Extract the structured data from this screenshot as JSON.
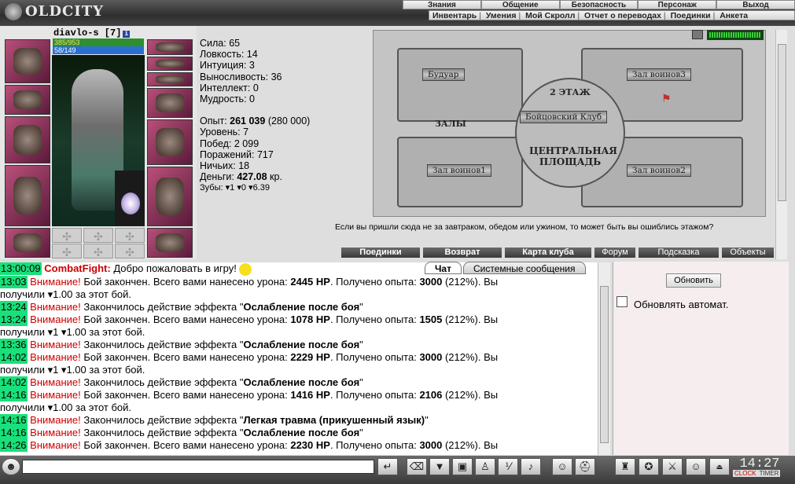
{
  "app": {
    "logo": "OLDCITY"
  },
  "menu_top": [
    "Знания",
    "Общение",
    "Безопасность",
    "Персонаж",
    "Выход"
  ],
  "menu_sub": [
    "Инвентарь",
    "Умения",
    "Мой Скролл",
    "Отчет о переводах",
    "Поединки",
    "Анкета"
  ],
  "character": {
    "nick": "diavlo-s [7]",
    "level_badge": "i",
    "hp": "385/953",
    "mp": "58/149",
    "avatar_icon": "armored-warrior-icon",
    "pet_icon": "pet-icon",
    "slot_icon": "equipment-slot-icon",
    "empty_slot_icon": "empty-slot-icon",
    "hp_fraction": 0.404,
    "mp_fraction": 0.389
  },
  "stats": {
    "strength": "Сила: 65",
    "agility": "Ловкость: 14",
    "intuition": "Интуиция: 3",
    "endurance": "Выносливость: 36",
    "intellect": "Интеллект: 0",
    "wisdom": "Мудрость: 0",
    "exp_label": "Опыт: ",
    "exp_value": "261 039",
    "exp_next": " (280 000)",
    "level": "Уровень: 7",
    "wins": "Побед: 2 099",
    "losses": "Поражений: 717",
    "draws": "Ничьих: 18",
    "money_label": "Деньги: ",
    "money_value": "427.08",
    "money_unit": " кр.",
    "teeth": "Зубы: ",
    "teeth_1": "1",
    "teeth_2": "0",
    "teeth_3": "6.39"
  },
  "map": {
    "room_boudoir": "Будуар",
    "room_warriors3": "Зал воинов3",
    "room_warriors1": "Зал воинов1",
    "room_warriors2": "Зал воинов2",
    "floor": "2 ЭТАЖ",
    "club": "Бойцовский Клуб",
    "halls": "ЗАЛЫ",
    "central": "ЦЕНТРАЛЬНАЯ ПЛОЩАДЬ",
    "message": "Если вы пришли сюда не за завтраком, обедом или ужином, то может быть вы ошиблись этажом?"
  },
  "map_buttons": [
    "Поединки",
    "Возврат",
    "Карта клуба",
    "Форум",
    "Подсказка",
    "Объекты"
  ],
  "chat_tabs": {
    "chat": "Чат",
    "system": "Системные сообщения"
  },
  "chat": [
    {
      "time": "13:00:09",
      "parts": [
        {
          "c": "cf",
          "t": "CombatFight:"
        },
        {
          "t": " Добро пожаловать в игру! "
        }
      ]
    },
    {
      "time": "13:03",
      "parts": [
        {
          "c": "w",
          "t": "Внимание!"
        },
        {
          "t": " Бой закончен. Всего вами нанесено урона: "
        },
        {
          "c": "b",
          "t": "2445 HP"
        },
        {
          "t": ". Получено опыта: "
        },
        {
          "c": "b",
          "t": "3000"
        },
        {
          "t": " (212%). Вы"
        }
      ]
    },
    {
      "time": "",
      "parts": [
        {
          "t": "получили ▾1.00 за этот бой."
        }
      ]
    },
    {
      "time": "13:24",
      "parts": [
        {
          "c": "w",
          "t": "Внимание!"
        },
        {
          "t": " Закончилось действие эффекта \""
        },
        {
          "c": "b",
          "t": "Ослабление после боя"
        },
        {
          "t": "\""
        }
      ]
    },
    {
      "time": "13:24",
      "parts": [
        {
          "c": "w",
          "t": "Внимание!"
        },
        {
          "t": " Бой закончен. Всего вами нанесено урона: "
        },
        {
          "c": "b",
          "t": "1078 HP"
        },
        {
          "t": ". Получено опыта: "
        },
        {
          "c": "b",
          "t": "1505"
        },
        {
          "t": " (212%). Вы"
        }
      ]
    },
    {
      "time": "",
      "parts": [
        {
          "t": "получили ▾1 ▾1.00 за этот бой."
        }
      ]
    },
    {
      "time": "13:36",
      "parts": [
        {
          "c": "w",
          "t": "Внимание!"
        },
        {
          "t": " Закончилось действие эффекта \""
        },
        {
          "c": "b",
          "t": "Ослабление после боя"
        },
        {
          "t": "\""
        }
      ]
    },
    {
      "time": "14:02",
      "parts": [
        {
          "c": "w",
          "t": "Внимание!"
        },
        {
          "t": " Бой закончен. Всего вами нанесено урона: "
        },
        {
          "c": "b",
          "t": "2229 HP"
        },
        {
          "t": ". Получено опыта: "
        },
        {
          "c": "b",
          "t": "3000"
        },
        {
          "t": " (212%). Вы"
        }
      ]
    },
    {
      "time": "",
      "parts": [
        {
          "t": "получили ▾1 ▾1.00 за этот бой."
        }
      ]
    },
    {
      "time": "14:02",
      "parts": [
        {
          "c": "w",
          "t": "Внимание!"
        },
        {
          "t": " Закончилось действие эффекта \""
        },
        {
          "c": "b",
          "t": "Ослабление после боя"
        },
        {
          "t": "\""
        }
      ]
    },
    {
      "time": "14:16",
      "parts": [
        {
          "c": "w",
          "t": "Внимание!"
        },
        {
          "t": " Бой закончен. Всего вами нанесено урона: "
        },
        {
          "c": "b",
          "t": "1416 HP"
        },
        {
          "t": ". Получено опыта: "
        },
        {
          "c": "b",
          "t": "2106"
        },
        {
          "t": " (212%). Вы"
        }
      ]
    },
    {
      "time": "",
      "parts": [
        {
          "t": "получили ▾1.00 за этот бой."
        }
      ]
    },
    {
      "time": "14:16",
      "parts": [
        {
          "c": "w",
          "t": "Внимание!"
        },
        {
          "t": " Закончилось действие эффекта \""
        },
        {
          "c": "b",
          "t": "Легкая травма (прикушенный язык)"
        },
        {
          "t": "\""
        }
      ]
    },
    {
      "time": "14:16",
      "parts": [
        {
          "c": "w",
          "t": "Внимание!"
        },
        {
          "t": " Закончилось действие эффекта \""
        },
        {
          "c": "b",
          "t": "Ослабление после боя"
        },
        {
          "t": "\""
        }
      ]
    },
    {
      "time": "14:26",
      "parts": [
        {
          "c": "w",
          "t": "Внимание!"
        },
        {
          "t": " Бой закончен. Всего вами нанесено урона: "
        },
        {
          "c": "b",
          "t": "2230 HP"
        },
        {
          "t": ". Получено опыта: "
        },
        {
          "c": "b",
          "t": "3000"
        },
        {
          "t": " (212%). Вы"
        }
      ]
    }
  ],
  "right_panel": {
    "refresh": "Обновить",
    "auto": "Обновлять автомат."
  },
  "toolbar": {
    "icons": [
      "chat-head-icon",
      "enter-icon",
      "eraser-icon",
      "filter-icon",
      "save-icon",
      "walk-icon",
      "smile-settings-icon",
      "sound-icon",
      "emoticon-icon",
      "helmet-icon",
      "inventory-icon",
      "skills-icon",
      "fight-icon",
      "friends-icon",
      "exit-icon"
    ],
    "clock": "14:27",
    "clock_label": "CLOCK",
    "timer_label": "TIMER",
    "clock_colors": {
      "clock": "#cc0000",
      "timer": "#cc0000"
    }
  },
  "colors": {
    "accent_red": "#cc0000",
    "time_green": "#19e07a",
    "hp_green": "#2f8f2f",
    "mp_blue": "#2a6fd0"
  }
}
